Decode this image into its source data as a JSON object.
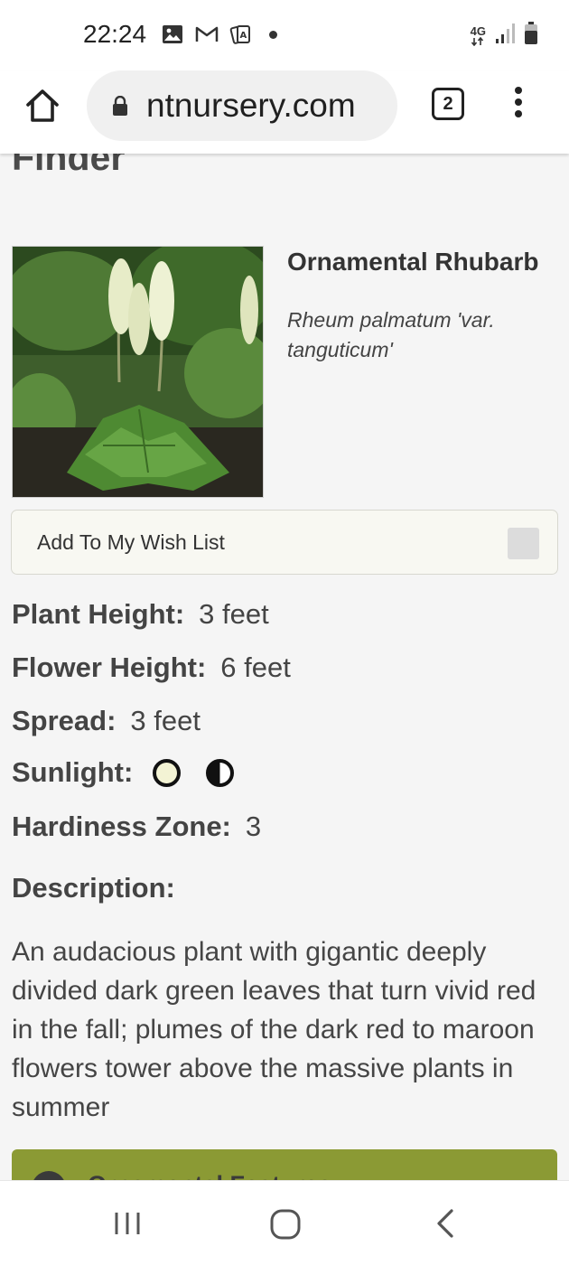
{
  "status_bar": {
    "time": "22:24",
    "icons": [
      "image-icon",
      "gmail-icon",
      "cards-icon"
    ],
    "network": "4G"
  },
  "browser": {
    "url": "ntnursery.com",
    "tab_count": "2"
  },
  "page": {
    "title": "Squak Mountain Nursery Plant Finder",
    "plant_name": "Ornamental Rhubarb",
    "latin_name": "Rheum palmatum 'var. tanguticum'",
    "wishlist_label": "Add To My Wish List",
    "attributes": {
      "plant_height_label": "Plant Height:",
      "plant_height_value": "3 feet",
      "flower_height_label": "Flower Height:",
      "flower_height_value": "6 feet",
      "spread_label": "Spread:",
      "spread_value": "3 feet",
      "sunlight_label": "Sunlight:",
      "sunlight_icons": [
        "full-sun-icon",
        "part-shade-icon"
      ],
      "hardiness_label": "Hardiness Zone:",
      "hardiness_value": "3"
    },
    "description_label": "Description:",
    "description": "An audacious plant with gigantic deeply divided dark green leaves that turn vivid red in the fall; plumes of the dark red to maroon flowers tower above the massive plants in summer",
    "feature_bar_label": "Ornamental Features",
    "feature_bar_color": "#8b9a34"
  },
  "nav": {
    "buttons": [
      "recents-icon",
      "home-icon",
      "back-icon"
    ]
  }
}
